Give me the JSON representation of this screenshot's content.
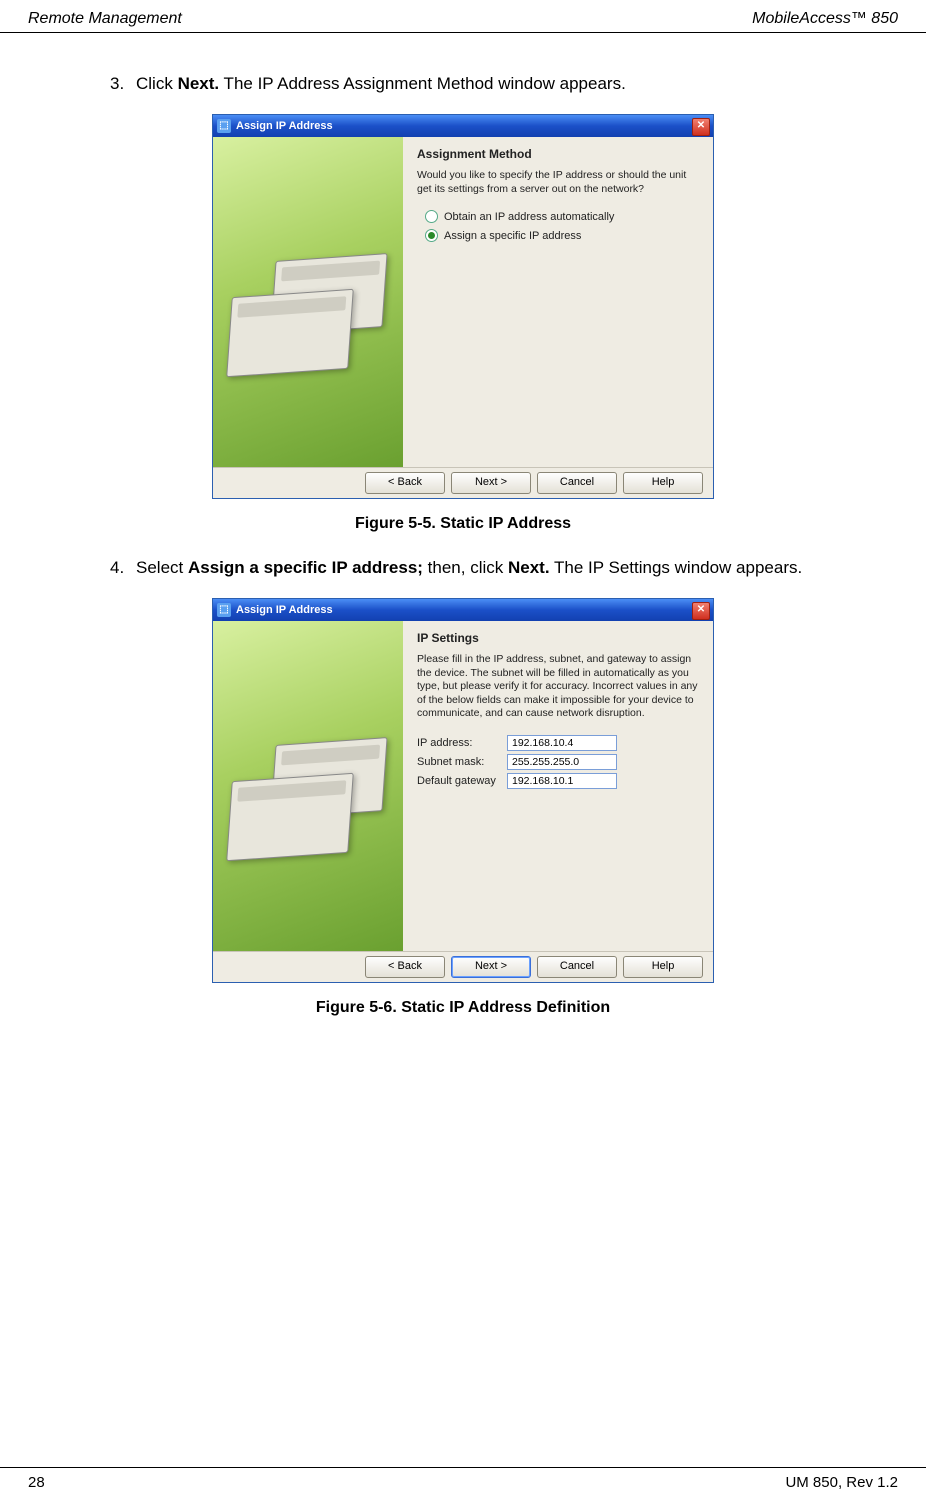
{
  "header": {
    "left": "Remote Management",
    "right": "MobileAccess™  850"
  },
  "footer": {
    "left": "28",
    "right": "UM 850, Rev 1.2"
  },
  "steps": {
    "s3": {
      "num": "3.",
      "prefix": "Click ",
      "bold1": "Next.",
      "rest": "  The IP Address Assignment Method window appears."
    },
    "s4": {
      "num": "4.",
      "prefix": "Select ",
      "bold1": "Assign a specific IP address;",
      "mid": " then, click ",
      "bold2": "Next.",
      "rest": " The IP Settings window appears."
    }
  },
  "captions": {
    "fig55": "Figure 5-5. Static IP Address",
    "fig56": "Figure 5-6. Static IP Address Definition"
  },
  "dialog1": {
    "title": "Assign IP Address",
    "section": "Assignment Method",
    "desc": "Would you like to specify the IP address or should the unit get its settings from a server out on the network?",
    "opt1": "Obtain an IP address automatically",
    "opt2": "Assign a specific IP address",
    "buttons": {
      "back": "< Back",
      "next": "Next >",
      "cancel": "Cancel",
      "help": "Help"
    }
  },
  "dialog2": {
    "title": "Assign IP Address",
    "section": "IP Settings",
    "desc": "Please fill in the IP address, subnet, and gateway to assign the device. The subnet will be filled in automatically as you type, but please verify it for accuracy.  Incorrect values in any of the below fields can make it impossible for your device to communicate, and can cause network disruption.",
    "fields": {
      "ip_label": "IP address:",
      "ip_value": "192.168.10.4",
      "subnet_label": "Subnet mask:",
      "subnet_value": "255.255.255.0",
      "gw_label": "Default gateway",
      "gw_value": "192.168.10.1"
    },
    "buttons": {
      "back": "< Back",
      "next": "Next >",
      "cancel": "Cancel",
      "help": "Help"
    }
  }
}
